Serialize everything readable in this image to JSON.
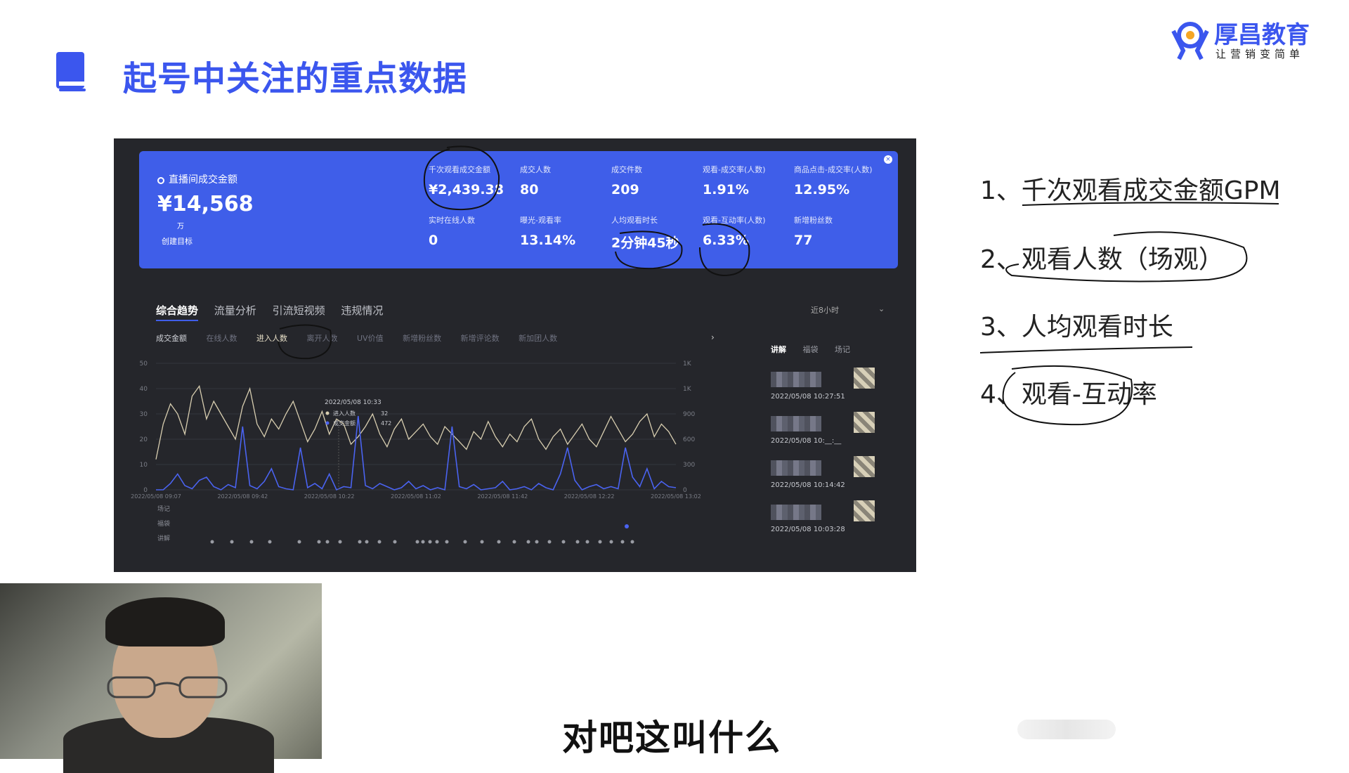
{
  "slide": {
    "title": "起号中关注的重点数据",
    "subtitle": "对吧这叫什么"
  },
  "logo": {
    "name": "厚昌教育",
    "slogan": "让营销变简单"
  },
  "dashboard": {
    "gmv_label": "直播间成交金额",
    "gmv_value": "¥14,568",
    "gmv_unit": "万",
    "create_target": "创建目标",
    "metrics_row1": [
      {
        "label": "千次观看成交金额",
        "value": "¥2,439.38"
      },
      {
        "label": "成交人数",
        "value": "80"
      },
      {
        "label": "成交件数",
        "value": "209"
      },
      {
        "label": "观看-成交率(人数)",
        "value": "1.91%"
      },
      {
        "label": "商品点击-成交率(人数)",
        "value": "12.95%"
      }
    ],
    "metrics_row2": [
      {
        "label": "实时在线人数",
        "value": "0"
      },
      {
        "label": "曝光-观看率",
        "value": "13.14%"
      },
      {
        "label": "人均观看时长",
        "value": "2分钟45秒"
      },
      {
        "label": "观看-互动率(人数)",
        "value": "6.33%"
      },
      {
        "label": "新增粉丝数",
        "value": "77"
      }
    ],
    "tabs": [
      "综合趋势",
      "流量分析",
      "引流短视频",
      "违规情况"
    ],
    "time_range": "近8小时",
    "legend": [
      "成交金额",
      "在线人数",
      "进入人数",
      "离开人数",
      "UV价值",
      "新增粉丝数",
      "新增评论数",
      "新加团人数"
    ],
    "tooltip": {
      "time": "2022/05/08 10:33",
      "rows": [
        {
          "label": "进入人数",
          "value": "32"
        },
        {
          "label": "成交金额",
          "value": "472"
        }
      ]
    },
    "row_labels": [
      "场记",
      "福袋",
      "讲解"
    ],
    "side_tabs": [
      "讲解",
      "福袋",
      "场记"
    ],
    "side_items": [
      {
        "time": "2022/05/08 10:27:51"
      },
      {
        "time": "2022/05/08 10:__:__"
      },
      {
        "time": "2022/05/08 10:14:42"
      },
      {
        "time": "2022/05/08 10:03:28"
      }
    ]
  },
  "chart_data": {
    "type": "line",
    "x_ticks": [
      "2022/05/08 09:07",
      "2022/05/08 09:42",
      "2022/05/08 10:22",
      "2022/05/08 11:02",
      "2022/05/08 11:42",
      "2022/05/08 12:22",
      "2022/05/08 13:02"
    ],
    "y_left_ticks": [
      "50",
      "40",
      "30",
      "20",
      "10",
      "0"
    ],
    "y_right_ticks": [
      "1K",
      "1K",
      "900",
      "600",
      "300",
      "0"
    ],
    "series": [
      {
        "name": "进入人数",
        "color": "#d8ceb0",
        "values": [
          12,
          26,
          34,
          30,
          22,
          37,
          41,
          28,
          35,
          30,
          25,
          20,
          33,
          40,
          26,
          21,
          28,
          24,
          30,
          35,
          27,
          19,
          24,
          31,
          22,
          28,
          26,
          18,
          21,
          25,
          30,
          22,
          17,
          24,
          28,
          20,
          23,
          26,
          21,
          18,
          25,
          22,
          19,
          16,
          23,
          20,
          27,
          21,
          17,
          22,
          19,
          25,
          28,
          20,
          16,
          21,
          24,
          18,
          22,
          26,
          20,
          17,
          23,
          29,
          24,
          19,
          22,
          27,
          30,
          21,
          26,
          23,
          18
        ]
      },
      {
        "name": "成交金额",
        "color": "#4a63f0",
        "values": [
          0,
          0,
          60,
          150,
          40,
          10,
          90,
          120,
          30,
          0,
          50,
          20,
          600,
          40,
          10,
          80,
          200,
          30,
          10,
          0,
          400,
          20,
          60,
          10,
          150,
          0,
          30,
          20,
          700,
          40,
          10,
          60,
          30,
          0,
          20,
          80,
          10,
          40,
          0,
          20,
          0,
          600,
          30,
          10,
          50,
          0,
          10,
          20,
          80,
          0,
          10,
          30,
          0,
          60,
          20,
          0,
          150,
          400,
          90,
          0,
          30,
          50,
          10,
          30,
          10,
          400,
          120,
          30,
          200,
          10,
          80,
          30,
          20
        ]
      }
    ]
  },
  "notes": [
    "1、千次观看成交金额GPM",
    "2、观看人数（场观）",
    "3、人均观看时长",
    "4、观看-互动率"
  ]
}
